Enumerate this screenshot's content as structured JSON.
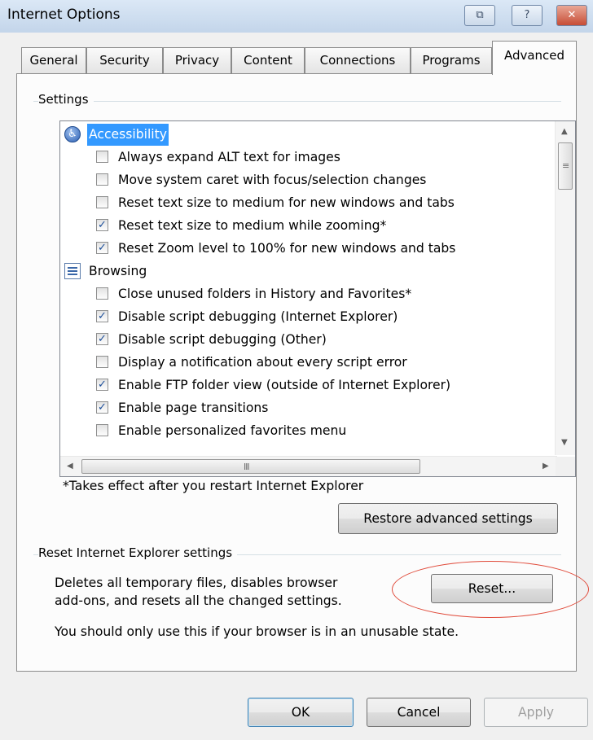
{
  "window": {
    "title": "Internet Options",
    "buttons": {
      "context_help": "⧉",
      "help": "?",
      "close": "✕"
    }
  },
  "tabs": [
    {
      "label": "General"
    },
    {
      "label": "Security"
    },
    {
      "label": "Privacy"
    },
    {
      "label": "Content"
    },
    {
      "label": "Connections"
    },
    {
      "label": "Programs"
    },
    {
      "label": "Advanced",
      "active": true
    }
  ],
  "settings": {
    "group_label": "Settings",
    "categories": [
      {
        "name": "Accessibility",
        "icon": "accessibility-icon",
        "selected": true,
        "items": [
          {
            "label": "Always expand ALT text for images",
            "checked": false
          },
          {
            "label": "Move system caret with focus/selection changes",
            "checked": false
          },
          {
            "label": "Reset text size to medium for new windows and tabs",
            "checked": false
          },
          {
            "label": "Reset text size to medium while zooming*",
            "checked": true
          },
          {
            "label": "Reset Zoom level to 100% for new windows and tabs",
            "checked": true
          }
        ]
      },
      {
        "name": "Browsing",
        "icon": "browsing-icon",
        "selected": false,
        "items": [
          {
            "label": "Close unused folders in History and Favorites*",
            "checked": false
          },
          {
            "label": "Disable script debugging (Internet Explorer)",
            "checked": true
          },
          {
            "label": "Disable script debugging (Other)",
            "checked": true
          },
          {
            "label": "Display a notification about every script error",
            "checked": false
          },
          {
            "label": "Enable FTP folder view (outside of Internet Explorer)",
            "checked": true
          },
          {
            "label": "Enable page transitions",
            "checked": true
          },
          {
            "label": "Enable personalized favorites menu",
            "checked": false
          }
        ]
      }
    ],
    "footnote": "*Takes effect after you restart Internet Explorer",
    "restore_button": "Restore advanced settings"
  },
  "reset": {
    "group_label": "Reset Internet Explorer settings",
    "description_line1": "Deletes all temporary files, disables browser",
    "description_line2": "add-ons, and resets all the changed settings.",
    "button": "Reset...",
    "warning": "You should only use this if your browser is in an unusable state."
  },
  "footer": {
    "ok": "OK",
    "cancel": "Cancel",
    "apply": "Apply"
  },
  "colors": {
    "selection": "#3399ff",
    "annotation": "#e04a3a",
    "check": "#1c4e99"
  }
}
